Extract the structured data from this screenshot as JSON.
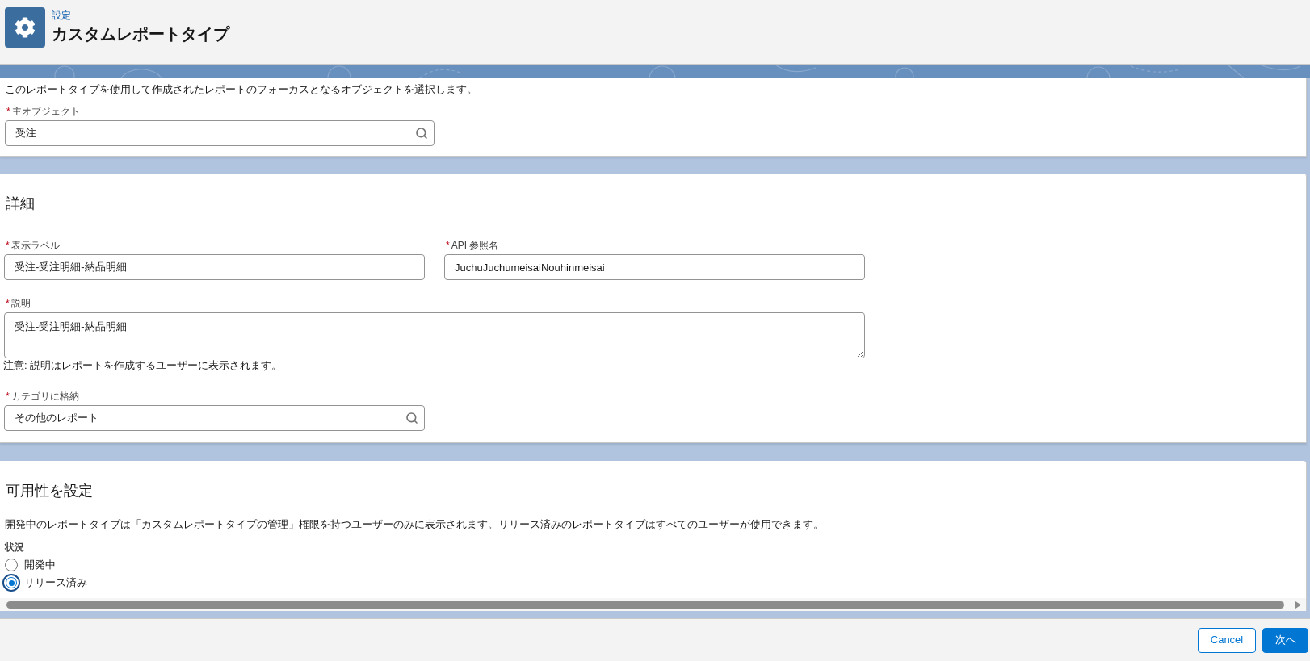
{
  "header": {
    "breadcrumb": "設定",
    "title": "カスタムレポートタイプ"
  },
  "primary_object_section": {
    "description": "このレポートタイプを使用して作成されたレポートのフォーカスとなるオブジェクトを選択します。",
    "field": {
      "kind": "lookup",
      "required_mark": "*",
      "label": "主オブジェクト",
      "value": "受注"
    }
  },
  "details_section": {
    "heading": "詳細",
    "fields": [
      {
        "kind": "text",
        "required_mark": "*",
        "label": "表示ラベル",
        "value": "受注-受注明細-納品明細"
      },
      {
        "kind": "text",
        "required_mark": "*",
        "label": "API 参照名",
        "value": "JuchuJuchumeisaiNouhinmeisai"
      },
      {
        "kind": "textarea",
        "required_mark": "*",
        "label": "説明",
        "value": "受注-受注明細-納品明細",
        "help": "注意: 説明はレポートを作成するユーザーに表示されます。"
      },
      {
        "kind": "lookup",
        "required_mark": "*",
        "label": "カテゴリに格納",
        "value": "その他のレポート"
      }
    ]
  },
  "availability_section": {
    "heading": "可用性を設定",
    "description": "開発中のレポートタイプは「カスタムレポートタイプの管理」権限を持つユーザーのみに表示されます。リリース済みのレポートタイプはすべてのユーザーが使用できます。",
    "status": {
      "label": "状況",
      "options": [
        {
          "label": "開発中",
          "selected": false
        },
        {
          "label": "リリース済み",
          "selected": true
        }
      ]
    }
  },
  "footer": {
    "buttons": [
      {
        "kind": "neutral",
        "label": "Cancel"
      },
      {
        "kind": "brand",
        "label": "次へ"
      }
    ]
  }
}
